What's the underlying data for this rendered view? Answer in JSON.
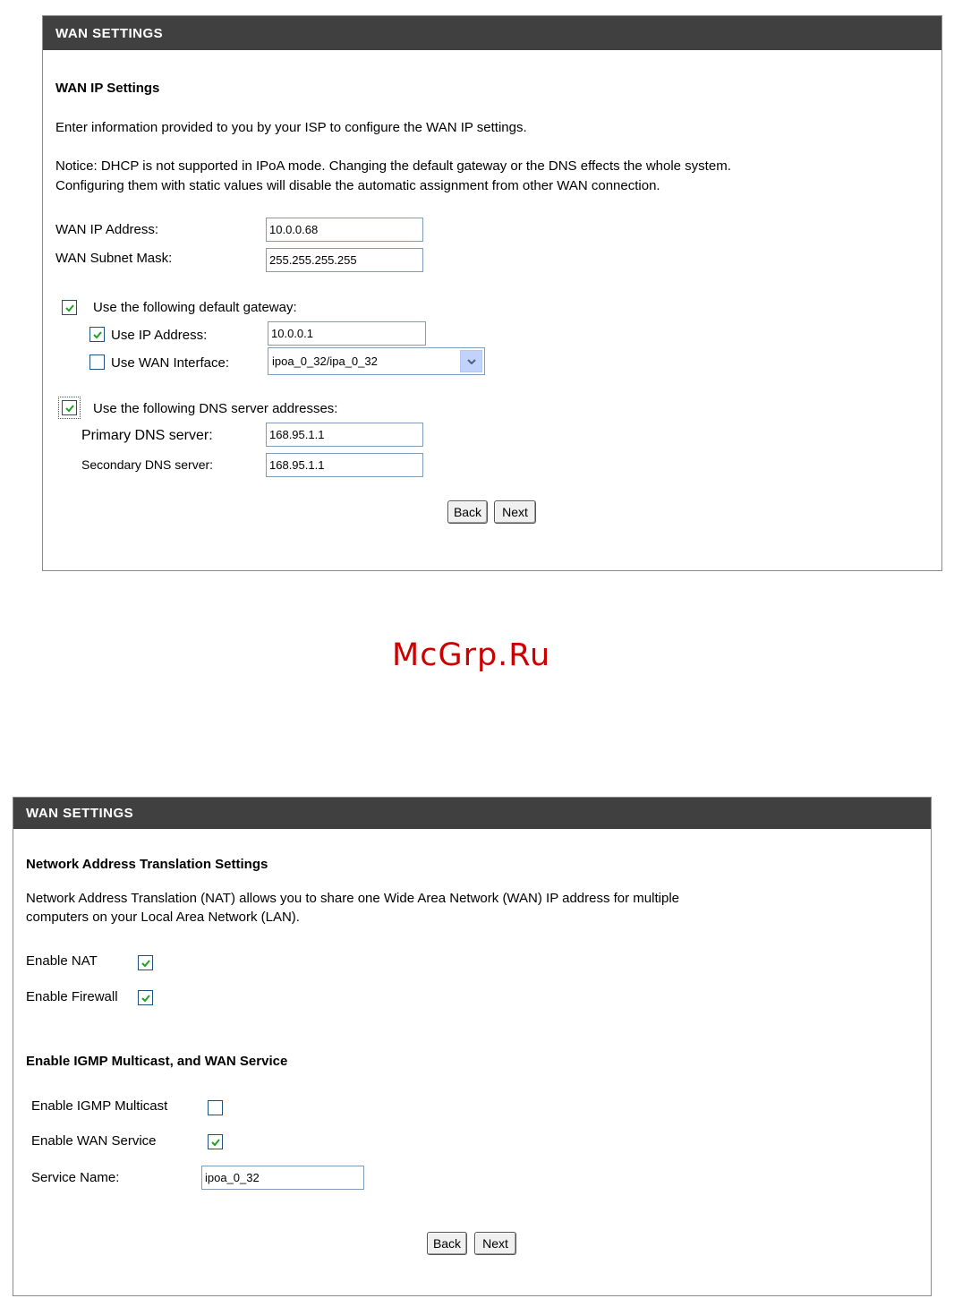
{
  "watermark": "McGrp.Ru",
  "panel1": {
    "title": "WAN SETTINGS",
    "section_heading": "WAN IP Settings",
    "intro": "Enter information provided to you by your ISP to configure the WAN IP settings.",
    "notice_line1": "Notice: DHCP is not supported in IPoA mode. Changing the default gateway or the DNS effects the whole system.",
    "notice_line2": "Configuring them with static values will disable the automatic assignment from other WAN connection.",
    "wan_ip_label": "WAN IP Address:",
    "wan_ip_value": "10.0.0.68",
    "wan_mask_label": "WAN Subnet Mask:",
    "wan_mask_value": "255.255.255.255",
    "gateway_label": "Use the following default gateway:",
    "gateway_checked": true,
    "use_ip_label": "Use IP Address:",
    "use_ip_checked": true,
    "use_ip_value": "10.0.0.1",
    "use_iface_label": "Use WAN Interface:",
    "use_iface_checked": false,
    "use_iface_value": "ipoa_0_32/ipa_0_32",
    "dns_label": "Use the following DNS server addresses:",
    "dns_checked": true,
    "primary_dns_label": "Primary DNS server:",
    "primary_dns_value": "168.95.1.1",
    "secondary_dns_label": "Secondary DNS server:",
    "secondary_dns_value": "168.95.1.1",
    "back_label": "Back",
    "next_label": "Next"
  },
  "panel2": {
    "title": "WAN SETTINGS",
    "nat_heading": "Network Address Translation Settings",
    "nat_desc_line1": "Network Address Translation (NAT) allows you to share one Wide Area Network (WAN) IP address for multiple",
    "nat_desc_line2": "computers on your Local Area Network (LAN).",
    "enable_nat_label": "Enable NAT",
    "enable_nat_checked": true,
    "enable_firewall_label": "Enable Firewall",
    "enable_firewall_checked": true,
    "igmp_heading": "Enable IGMP Multicast, and WAN Service",
    "enable_igmp_label": "Enable IGMP Multicast",
    "enable_igmp_checked": false,
    "enable_wan_label": "Enable WAN Service",
    "enable_wan_checked": true,
    "service_name_label": "Service Name:",
    "service_name_value": "ipoa_0_32",
    "back_label": "Back",
    "next_label": "Next"
  }
}
